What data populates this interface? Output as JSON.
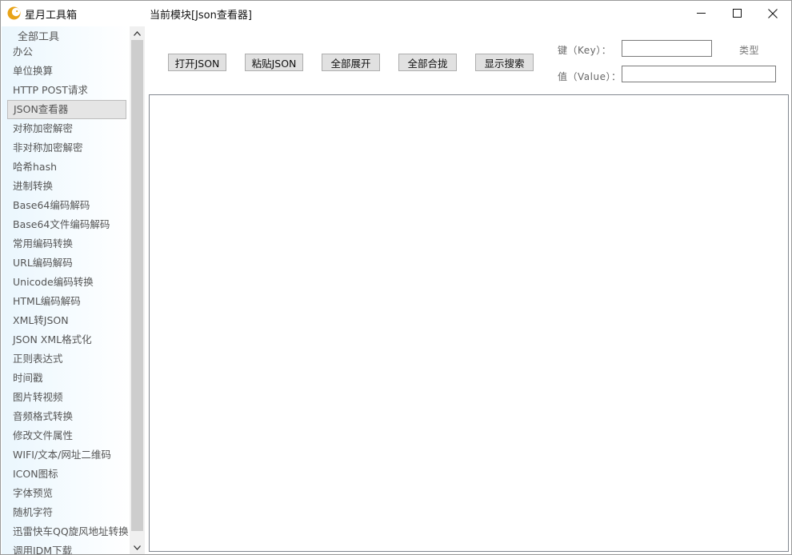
{
  "window": {
    "app_title": "星月工具箱",
    "module_title": "当前模块[Json查看器]",
    "accent_color": "#e8a317"
  },
  "sidebar": {
    "header": "全部工具",
    "selected_index": 3,
    "items": [
      "办公",
      "单位换算",
      "HTTP POST请求",
      "JSON查看器",
      "对称加密解密",
      "非对称加密解密",
      "哈希hash",
      "进制转换",
      "Base64编码解码",
      "Base64文件编码解码",
      "常用编码转换",
      "URL编码解码",
      "Unicode编码转换",
      "HTML编码解码",
      "XML转JSON",
      "JSON XML格式化",
      "正则表达式",
      "时间戳",
      "图片转视频",
      "音频格式转换",
      "修改文件属性",
      "WIFI/文本/网址二维码",
      "ICON图标",
      "字体预览",
      "随机字符",
      "迅雷快车QQ旋风地址转换",
      "调用IDM下载"
    ]
  },
  "toolbar": {
    "open_json": "打开JSON",
    "paste_json": "粘贴JSON",
    "expand_all": "全部展开",
    "collapse_all": "全部合拢",
    "show_search": "显示搜索"
  },
  "search": {
    "key_label": "键（Key）：",
    "key_value": "",
    "type_label": "类型",
    "value_label": "值（Value）：",
    "value_value": ""
  }
}
